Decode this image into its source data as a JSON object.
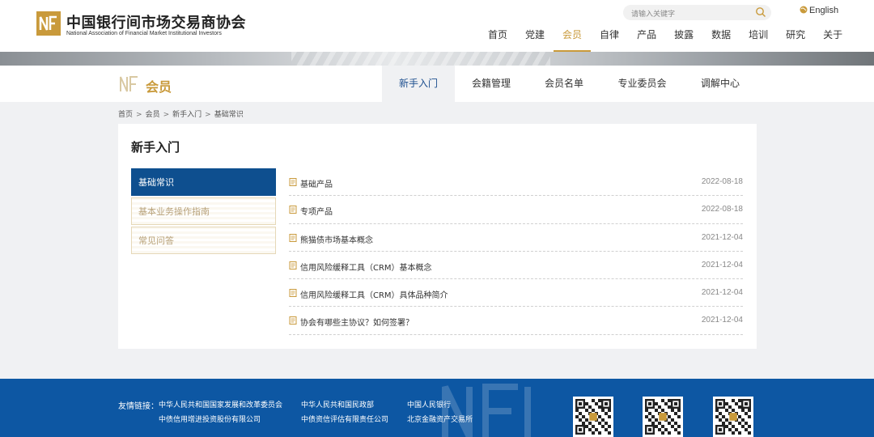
{
  "header": {
    "logo_cn": "中国银行间市场交易商协会",
    "logo_en": "National Association of Financial Market Institutional Investors",
    "search_placeholder": "请输入关键字",
    "language": "English",
    "nav": [
      "首页",
      "党建",
      "会员",
      "自律",
      "产品",
      "披露",
      "数据",
      "培训",
      "研究",
      "关于"
    ],
    "active_nav": "会员"
  },
  "subheader": {
    "title": "会员",
    "tabs": [
      "新手入门",
      "会籍管理",
      "会员名单",
      "专业委员会",
      "调解中心"
    ],
    "active_tab": "新手入门"
  },
  "breadcrumb": [
    "首页",
    "会员",
    "新手入门",
    "基础常识"
  ],
  "panel": {
    "title": "新手入门",
    "side_menu": [
      "基础常识",
      "基本业务操作指南",
      "常见问答"
    ],
    "active_side": "基础常识",
    "articles": [
      {
        "title": "基础产品",
        "date": "2022-08-18"
      },
      {
        "title": "专项产品",
        "date": "2022-08-18"
      },
      {
        "title": "熊猫债市场基本概念",
        "date": "2021-12-04"
      },
      {
        "title": "信用风险缓释工具（CRM）基本概念",
        "date": "2021-12-04"
      },
      {
        "title": "信用风险缓释工具（CRM）具体品种简介",
        "date": "2021-12-04"
      },
      {
        "title": "协会有哪些主协议？如何签署？",
        "date": "2021-12-04"
      }
    ]
  },
  "footer": {
    "links_label": "友情链接：",
    "links": [
      "中华人民共和国国家发展和改革委员会",
      "中华人民共和国民政部",
      "中国人民银行",
      "中债信用增进投资股份有限公司",
      "中债资信评估有限责任公司",
      "北京金融资产交易所"
    ]
  },
  "colors": {
    "accent_gold": "#c99a3b",
    "primary_blue": "#0e4f8f",
    "footer_blue": "#0d57a3"
  }
}
